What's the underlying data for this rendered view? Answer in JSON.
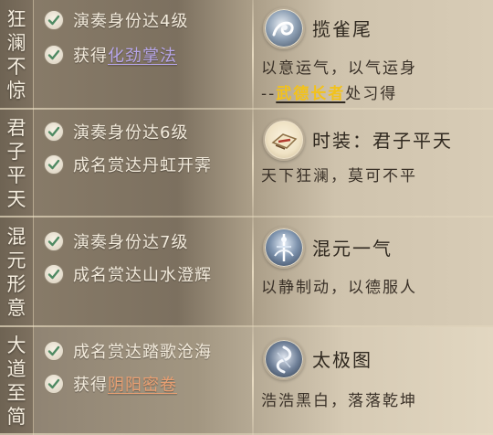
{
  "rows": [
    {
      "title": "狂澜不惊",
      "conditions": [
        {
          "text": "演奏身份达4级",
          "highlight": ""
        },
        {
          "text": "获得",
          "highlight": "化劲掌法",
          "highlight_color": "#b7a6e8"
        }
      ],
      "reward": {
        "icon": "swirl-technique-icon",
        "name": "揽雀尾",
        "desc_line1": "以意运气，以气运身",
        "desc_line2_prefix": "--",
        "desc_line2_highlight": "武德长者",
        "desc_line2_suffix": "处习得"
      }
    },
    {
      "title": "君子平天",
      "conditions": [
        {
          "text": "演奏身份达6级",
          "highlight": ""
        },
        {
          "text": "成名赏达丹虹开霁",
          "highlight": ""
        }
      ],
      "reward": {
        "icon": "outfit-bundle-icon",
        "name": "时装：君子平天",
        "desc_line1": "天下狂澜，莫可不平"
      }
    },
    {
      "title": "混元形意",
      "conditions": [
        {
          "text": "演奏身份达7级",
          "highlight": ""
        },
        {
          "text": "成名赏达山水澄辉",
          "highlight": ""
        }
      ],
      "reward": {
        "icon": "sword-skill-icon",
        "name": "混元一气",
        "desc_line1": "以静制动，以德服人"
      }
    },
    {
      "title": "大道至简",
      "conditions": [
        {
          "text": "成名赏达踏歌沧海",
          "highlight": ""
        },
        {
          "text": "获得",
          "highlight": "阴阳密卷",
          "highlight_color": "#e9a073"
        }
      ],
      "reward": {
        "icon": "taiji-figure-icon",
        "name": "太极图",
        "desc_line1": "浩浩黑白，落落乾坤"
      }
    }
  ],
  "colors": {
    "purple_link": "#b7a6e8",
    "orange_link": "#e9a073",
    "gold_npc": "#f3c21a"
  }
}
